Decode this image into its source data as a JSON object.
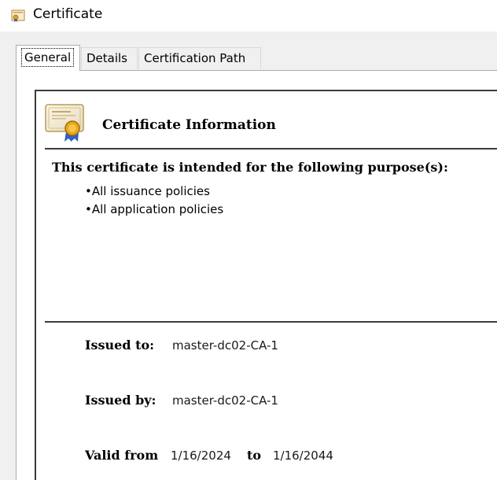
{
  "window": {
    "title": "Certificate",
    "icon": "certificate-icon"
  },
  "tabs": [
    {
      "label": "General",
      "selected": true
    },
    {
      "label": "Details",
      "selected": false
    },
    {
      "label": "Certification Path",
      "selected": false
    }
  ],
  "info": {
    "header": "Certificate Information",
    "icon": "certificate-icon",
    "purpose_heading": "This certificate is intended for the following purpose(s):",
    "purposes": [
      "All issuance policies",
      "All application policies"
    ]
  },
  "fields": {
    "issued_to_label": "Issued to:",
    "issued_to_value": "master-dc02-CA-1",
    "issued_by_label": "Issued by:",
    "issued_by_value": "master-dc02-CA-1",
    "valid_from_label": "Valid from",
    "valid_from_value": "1/16/2024",
    "valid_to_label": "to",
    "valid_to_value": "1/16/2044"
  },
  "colors": {
    "dialog_bg": "#f0f0f0",
    "panel_bg": "#ffffff",
    "rule": "#3c3c3c"
  }
}
